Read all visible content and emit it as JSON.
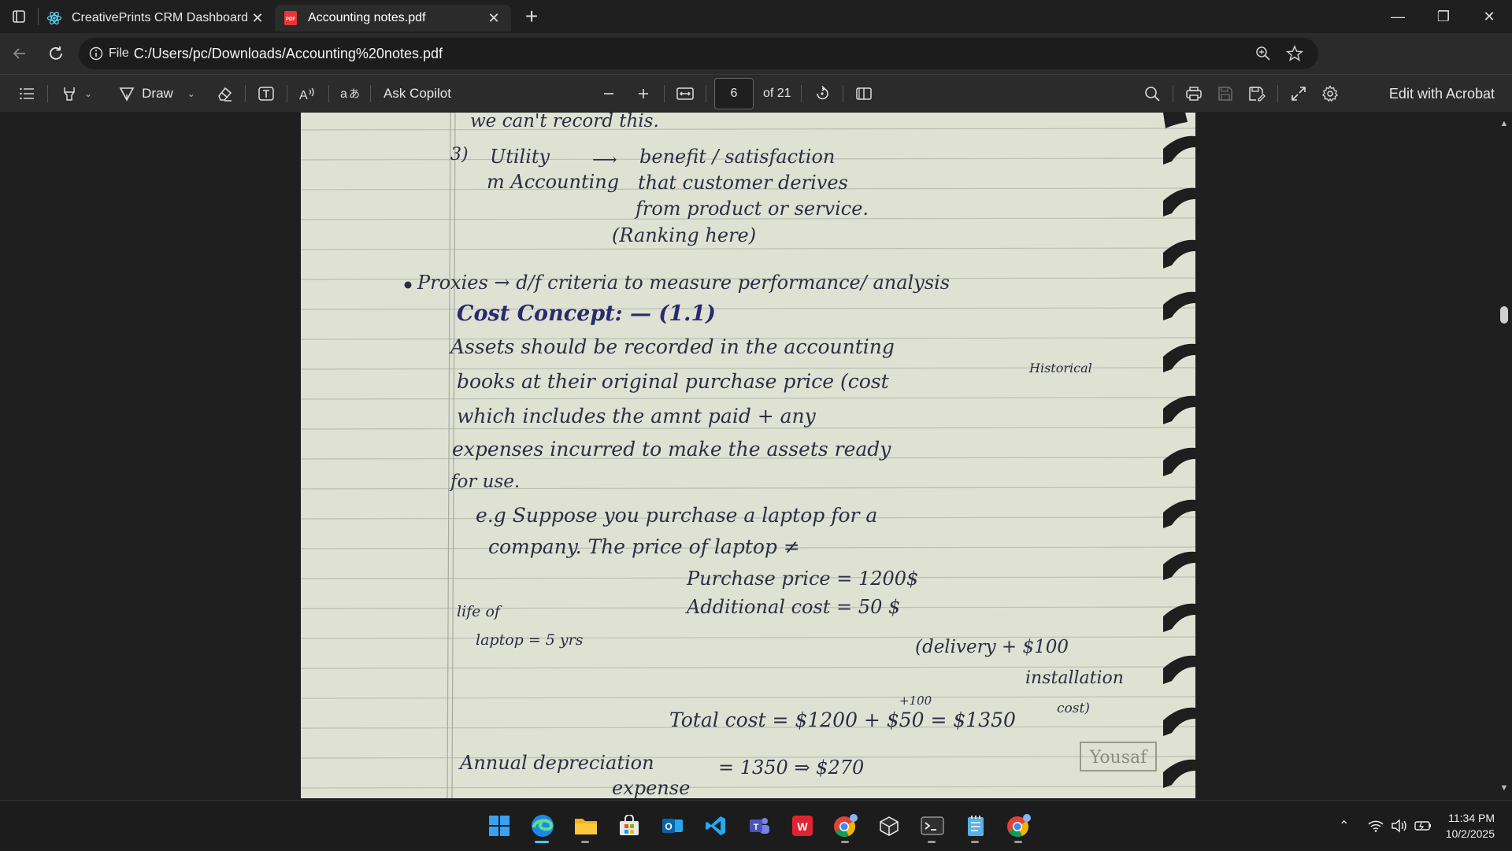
{
  "tabs": [
    {
      "title": "CreativePrints CRM Dashboard",
      "active": false
    },
    {
      "title": "Accounting notes.pdf",
      "active": true
    }
  ],
  "address": {
    "scheme_label": "File",
    "url": "C:/Users/pc/Downloads/Accounting%20notes.pdf"
  },
  "pdf_toolbar": {
    "draw_label": "Draw",
    "copilot_label": "Ask Copilot",
    "page_number": "6",
    "page_total": "of 21",
    "acrobat_label": "Edit with Acrobat"
  },
  "notes": {
    "l1": "we can't record this.",
    "l2a": "Utility",
    "l2b": "m Accounting",
    "l2c": "benefit / satisfaction",
    "l3": "that customer derives",
    "l4": "from product or service.",
    "l5": "(Ranking here)",
    "l6": "Proxies → d/f criteria to measure performance/ analysis",
    "heading": "Cost Concept: — (1.1)",
    "l7": "Assets should be recorded in the accounting",
    "l8": "books at their original purchase price (cost",
    "l8b": "Historical",
    "l9": "which includes the amnt paid + any",
    "l10": "expenses incurred to make the assets ready",
    "l11": "for use.",
    "l12": "e.g Suppose you purchase a laptop for a",
    "l13": "company. The price of laptop ≠",
    "l14": "Purchase price = 1200$",
    "l15": "Additional cost = 50 $",
    "l16a": "life of",
    "l16b": "laptop = 5 yrs",
    "l17": "(delivery + $100",
    "l18": "installation",
    "l19": "Total cost = $1200 + $50 = $1350",
    "l19b": "+100",
    "l19c": "cost)",
    "l20": "Annual depreciation",
    "l20b": "= 1350 ⇒ $270",
    "l21": "expense",
    "stamp": "Yousaf"
  },
  "clock": {
    "time": "11:34 PM",
    "date": "10/2/2025"
  },
  "colors": {
    "accent": "#4cc2ff",
    "paper": "#dfe2d3",
    "ink": "#2a2e44"
  }
}
